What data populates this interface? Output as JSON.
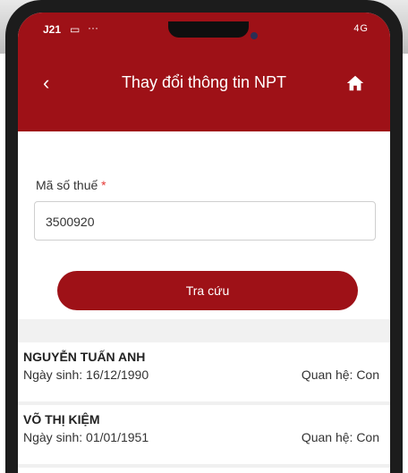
{
  "status_bar": {
    "time": "J21",
    "right": "4G"
  },
  "header": {
    "title": "Thay đổi thông tin NPT"
  },
  "form": {
    "tax_label": "Mã số thuế",
    "required_mark": "*",
    "tax_value": "3500920",
    "search_button_label": "Tra cứu"
  },
  "dependents": [
    {
      "name": "NGUYỄN TUẤN ANH",
      "dob": "Ngày sinh: 16/12/1990",
      "relation": "Quan hệ: Con"
    },
    {
      "name": "VÕ THỊ KIỆM",
      "dob": "Ngày sinh: 01/01/1951",
      "relation": "Quan hệ: Con"
    }
  ],
  "colors": {
    "brand_red": "#9e1117",
    "required_red": "#e53935"
  },
  "icons": [
    "back-chevron-icon",
    "home-icon"
  ]
}
